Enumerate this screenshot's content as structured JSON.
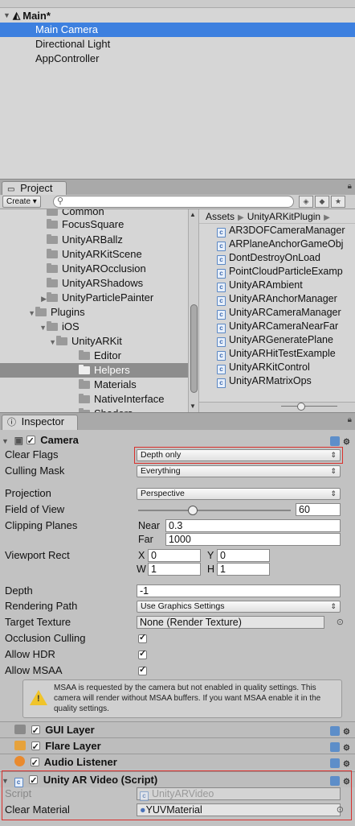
{
  "hierarchy": {
    "scene_name": "Main*",
    "items": [
      {
        "label": "Main Camera",
        "selected": true
      },
      {
        "label": "Directional Light",
        "selected": false
      },
      {
        "label": "AppController",
        "selected": false
      }
    ]
  },
  "project": {
    "tab_label": "Project",
    "create_label": "Create",
    "tree": [
      {
        "label": "Common",
        "indent": 1
      },
      {
        "label": "FocusSquare",
        "indent": 1
      },
      {
        "label": "UnityARBallz",
        "indent": 1
      },
      {
        "label": "UnityARKitScene",
        "indent": 1
      },
      {
        "label": "UnityAROcclusion",
        "indent": 1
      },
      {
        "label": "UnityARShadows",
        "indent": 1
      },
      {
        "label": "UnityParticlePainter",
        "indent": 1,
        "expander": "right"
      },
      {
        "label": "Plugins",
        "indent": 0,
        "expander": "down"
      },
      {
        "label": "iOS",
        "indent": 1,
        "expander": "down"
      },
      {
        "label": "UnityARKit",
        "indent": 2,
        "expander": "down"
      },
      {
        "label": "Editor",
        "indent": 3
      },
      {
        "label": "Helpers",
        "indent": 3,
        "selected": true
      },
      {
        "label": "Materials",
        "indent": 3
      },
      {
        "label": "NativeInterface",
        "indent": 3
      },
      {
        "label": "Shaders",
        "indent": 3
      }
    ],
    "breadcrumb": [
      "Assets",
      "UnityARKitPlugin"
    ],
    "files": [
      "AR3DOFCameraManager",
      "ARPlaneAnchorGameObj",
      "DontDestroyOnLoad",
      "PointCloudParticleExamp",
      "UnityARAmbient",
      "UnityARAnchorManager",
      "UnityARCameraManager",
      "UnityARCameraNearFar",
      "UnityARGeneratePlane",
      "UnityARHitTestExample",
      "UnityARKitControl",
      "UnityARMatrixOps"
    ]
  },
  "inspector": {
    "tab_label": "Inspector",
    "camera": {
      "title": "Camera",
      "clear_flags_label": "Clear Flags",
      "clear_flags_value": "Depth only",
      "culling_mask_label": "Culling Mask",
      "culling_mask_value": "Everything",
      "projection_label": "Projection",
      "projection_value": "Perspective",
      "fov_label": "Field of View",
      "fov_value": "60",
      "fov_slider_fraction": 0.36,
      "clipping_label": "Clipping Planes",
      "near_label": "Near",
      "near_value": "0.3",
      "far_label": "Far",
      "far_value": "1000",
      "viewport_label": "Viewport Rect",
      "vp_x_label": "X",
      "vp_x": "0",
      "vp_y_label": "Y",
      "vp_y": "0",
      "vp_w_label": "W",
      "vp_w": "1",
      "vp_h_label": "H",
      "vp_h": "1",
      "depth_label": "Depth",
      "depth_value": "-1",
      "rendering_path_label": "Rendering Path",
      "rendering_path_value": "Use Graphics Settings",
      "target_texture_label": "Target Texture",
      "target_texture_value": "None (Render Texture)",
      "occlusion_label": "Occlusion Culling",
      "allow_hdr_label": "Allow HDR",
      "allow_msaa_label": "Allow MSAA",
      "warning": "MSAA is requested by the camera but not enabled in quality settings. This camera will render without MSAA buffers. If you want MSAA enable it in the quality settings."
    },
    "gui_layer_title": "GUI Layer",
    "flare_layer_title": "Flare Layer",
    "audio_listener_title": "Audio Listener",
    "ar_video": {
      "title": "Unity AR Video (Script)",
      "script_label": "Script",
      "script_value": "UnityARVideo",
      "clear_material_label": "Clear Material",
      "clear_material_value": "YUVMaterial"
    }
  },
  "colors": {
    "selection": "#3d80df",
    "highlight_box": "#d9302c"
  }
}
